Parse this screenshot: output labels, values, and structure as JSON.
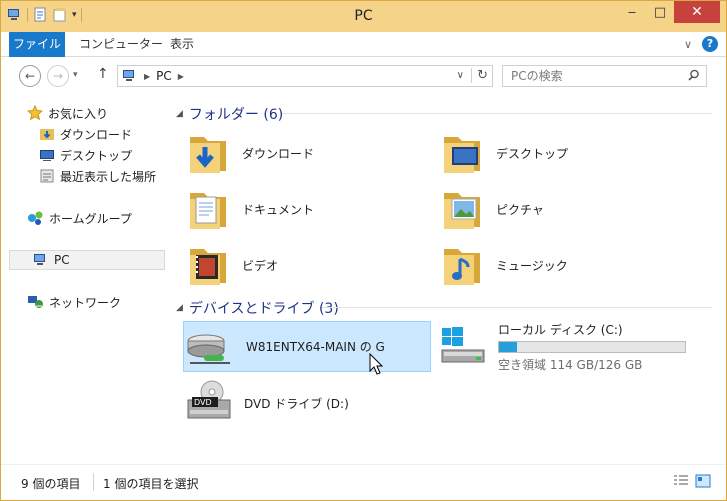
{
  "window": {
    "title": "PC"
  },
  "ribbon": {
    "tabs": [
      "ファイル",
      "コンピューター",
      "表示"
    ]
  },
  "address": {
    "path": [
      "PC"
    ]
  },
  "search": {
    "placeholder": "PCの検索"
  },
  "navpane": {
    "items": [
      {
        "label": "お気に入り",
        "icon": "star-icon"
      },
      {
        "label": "ダウンロード",
        "icon": "downloads-folder-icon"
      },
      {
        "label": "デスクトップ",
        "icon": "desktop-icon"
      },
      {
        "label": "最近表示した場所",
        "icon": "recent-places-icon"
      },
      {
        "label": "ホームグループ",
        "icon": "homegroup-icon"
      },
      {
        "label": "PC",
        "icon": "pc-icon"
      },
      {
        "label": "ネットワーク",
        "icon": "network-icon"
      }
    ]
  },
  "groups": {
    "folders": {
      "label": "フォルダー (6)",
      "items": [
        "ダウンロード",
        "デスクトップ",
        "ドキュメント",
        "ピクチャ",
        "ビデオ",
        "ミュージック"
      ]
    },
    "drives": {
      "label": "デバイスとドライブ (3)",
      "network_drive": "W81ENTX64-MAIN の G",
      "local_disk": {
        "label": "ローカル ディスク (C:)",
        "used_fraction": 0.095,
        "free_text": "空き領域 114 GB/126 GB"
      },
      "dvd": "DVD ドライブ (D:)"
    }
  },
  "status": {
    "count": "9 個の項目",
    "selected": "1 個の項目を選択"
  },
  "colors": {
    "accent": "#1979ca",
    "selection": "#cce8ff",
    "frame": "#f5d48a",
    "bar": "#26a0da",
    "close": "#c7423d"
  }
}
